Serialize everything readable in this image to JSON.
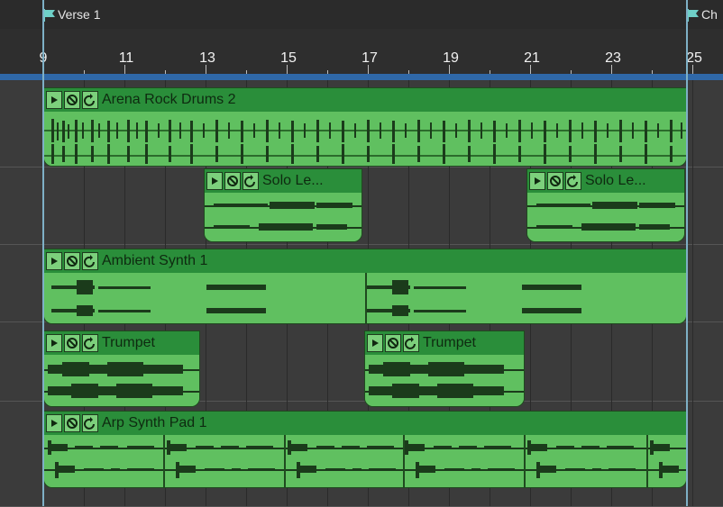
{
  "markers": [
    {
      "label": "Verse 1",
      "color": "#6fd0c8"
    },
    {
      "label": "Ch",
      "color": "#6fd0c8"
    }
  ],
  "ruler": {
    "numbers": [
      "9",
      "11",
      "13",
      "15",
      "17",
      "19",
      "21",
      "23",
      "25"
    ]
  },
  "colors": {
    "clip": "#58b858",
    "clip_header": "#2a8e3a",
    "ruler_strip": "#2f68a8",
    "playhead": "#7eb0c6"
  },
  "tracks": [
    {
      "clips": [
        {
          "name": "Arena Rock Drums 2"
        }
      ]
    },
    {
      "clips": [
        {
          "name": "Solo Le..."
        },
        {
          "name": "Solo Le..."
        }
      ]
    },
    {
      "clips": [
        {
          "name": "Ambient Synth 1"
        }
      ]
    },
    {
      "clips": [
        {
          "name": "Trumpet"
        },
        {
          "name": "Trumpet"
        }
      ]
    },
    {
      "clips": [
        {
          "name": "Arp Synth Pad 1"
        }
      ]
    }
  ]
}
